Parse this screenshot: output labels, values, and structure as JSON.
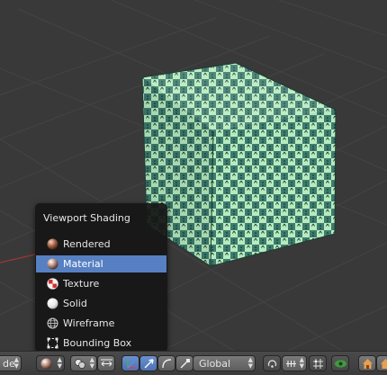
{
  "menu": {
    "title": "Viewport Shading",
    "items": [
      {
        "label": "Rendered",
        "icon": "rendered-sphere-icon"
      },
      {
        "label": "Material",
        "icon": "material-sphere-icon",
        "selected": true
      },
      {
        "label": "Texture",
        "icon": "texture-checker-icon"
      },
      {
        "label": "Solid",
        "icon": "solid-sphere-icon"
      },
      {
        "label": "Wireframe",
        "icon": "wireframe-sphere-icon"
      },
      {
        "label": "Bounding Box",
        "icon": "bounding-box-icon"
      }
    ]
  },
  "header": {
    "mode_label_partial": "de",
    "orientation": "Global"
  },
  "colors": {
    "checker_dark": "#3e7c6e",
    "checker_light": "#b6ebbe",
    "menu_highlight": "#5680c2",
    "grid_background": "#393939"
  }
}
